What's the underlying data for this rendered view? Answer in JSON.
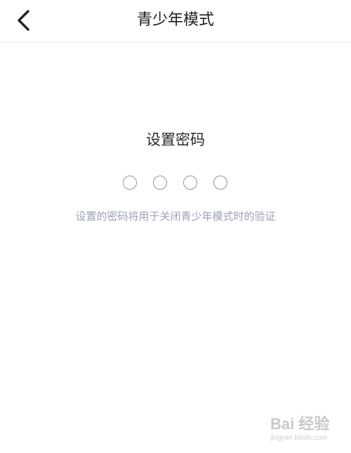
{
  "header": {
    "title": "青少年模式",
    "back_icon": "chevron-left-icon"
  },
  "main": {
    "heading": "设置密码",
    "pin_length": 4,
    "pin_filled": 0,
    "hint": "设置的密码将用于关闭青少年模式时的验证"
  },
  "watermark": {
    "logo": "Bai 经验",
    "url": "jingyan.baidu.com"
  },
  "colors": {
    "title": "#1f1f1f",
    "hint": "#9aa2b5",
    "dot_border": "#9096a3",
    "divider": "#ededed"
  }
}
